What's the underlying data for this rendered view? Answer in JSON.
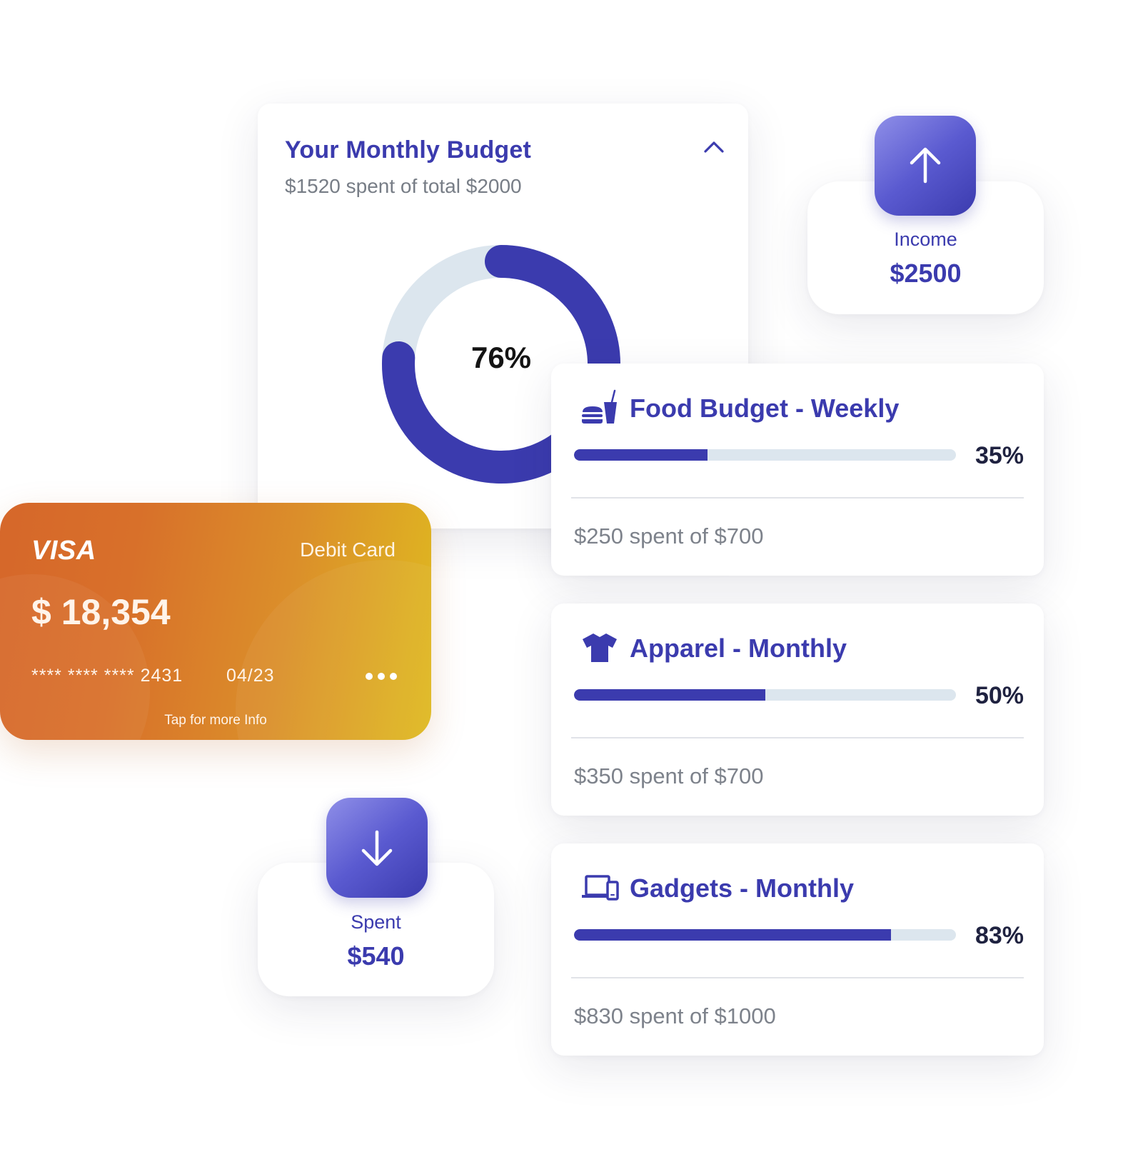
{
  "budget": {
    "title": "Your Monthly Budget",
    "subtitle": "$1520 spent of total $2000",
    "percent_label": "76%",
    "percent": 76
  },
  "income": {
    "label": "Income",
    "value": "$2500"
  },
  "spent": {
    "label": "Spent",
    "value": "$540"
  },
  "card": {
    "brand": "VISA",
    "type": "Debit Card",
    "balance": "$ 18,354",
    "number": "**** **** **** 2431",
    "expiry": "04/23",
    "tap_text": "Tap for more Info"
  },
  "categories": [
    {
      "icon": "food-icon",
      "title": "Food Budget - Weekly",
      "percent_label": "35%",
      "percent": 35,
      "spent": "$250 spent of $700"
    },
    {
      "icon": "shirt-icon",
      "title": "Apparel - Monthly",
      "percent_label": "50%",
      "percent": 50,
      "spent": "$350 spent of $700"
    },
    {
      "icon": "devices-icon",
      "title": "Gadgets - Monthly",
      "percent_label": "83%",
      "percent": 83,
      "spent": "$830 spent of $1000"
    }
  ],
  "colors": {
    "primary": "#3b3bae",
    "track": "#dce6ee",
    "card_gradient_start": "#d6672a",
    "card_gradient_end": "#dfba20"
  }
}
